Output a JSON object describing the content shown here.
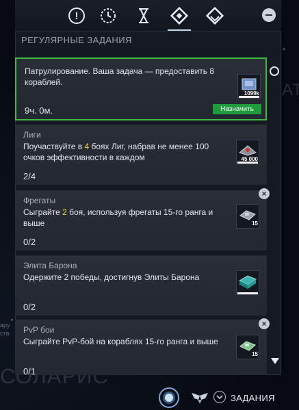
{
  "background": {
    "map_labels": [
      "СОЛАРИС",
      "АТРИ"
    ],
    "map_small": [
      "ару",
      "ста"
    ]
  },
  "tabs": [
    {
      "icon": "exclamation-icon"
    },
    {
      "icon": "clock-icon"
    },
    {
      "icon": "hourglass-icon"
    },
    {
      "icon": "diamond-grid-icon",
      "active": true
    },
    {
      "icon": "layers-diamond-icon"
    }
  ],
  "section_title": "РЕГУЛЯРНЫЕ ЗАДАНИЯ",
  "quests": [
    {
      "name": "",
      "description": "Патрулирование. Ваша задача — предоставить 8 кораблей.",
      "progress": "9ч. 0м.",
      "reward_count": "1099k",
      "button": "Назначить"
    },
    {
      "name": "Лиги",
      "desc_before": "Поучаствуйте в ",
      "desc_accent": "4",
      "desc_after": " боях Лиг, набрав не менее 100 очков эффективности в каждом",
      "progress": "2/4",
      "reward_count": "45 000"
    },
    {
      "name": "Фрегаты",
      "desc_before": "Сыграйте ",
      "desc_accent": "2",
      "desc_after": " боя, используя фрегаты 15-го ранга и выше",
      "progress": "0/2",
      "reward_count": "15"
    },
    {
      "name": "Элита Барона",
      "description": "Одержите 2 победы, достигнув Элиты Барона",
      "progress": "0/2",
      "reward_count": ""
    },
    {
      "name": "PvP бои",
      "description": "Сыграйте PvP-бой на кораблях 15-го ранга и выше",
      "progress": "0/1",
      "reward_count": "15"
    }
  ],
  "hud": {
    "label": "ЗАДАНИЯ"
  },
  "colors": {
    "accent_green": "#1f9b3c",
    "selected_border": "#45b84a",
    "highlight_number": "#f1d24a"
  }
}
